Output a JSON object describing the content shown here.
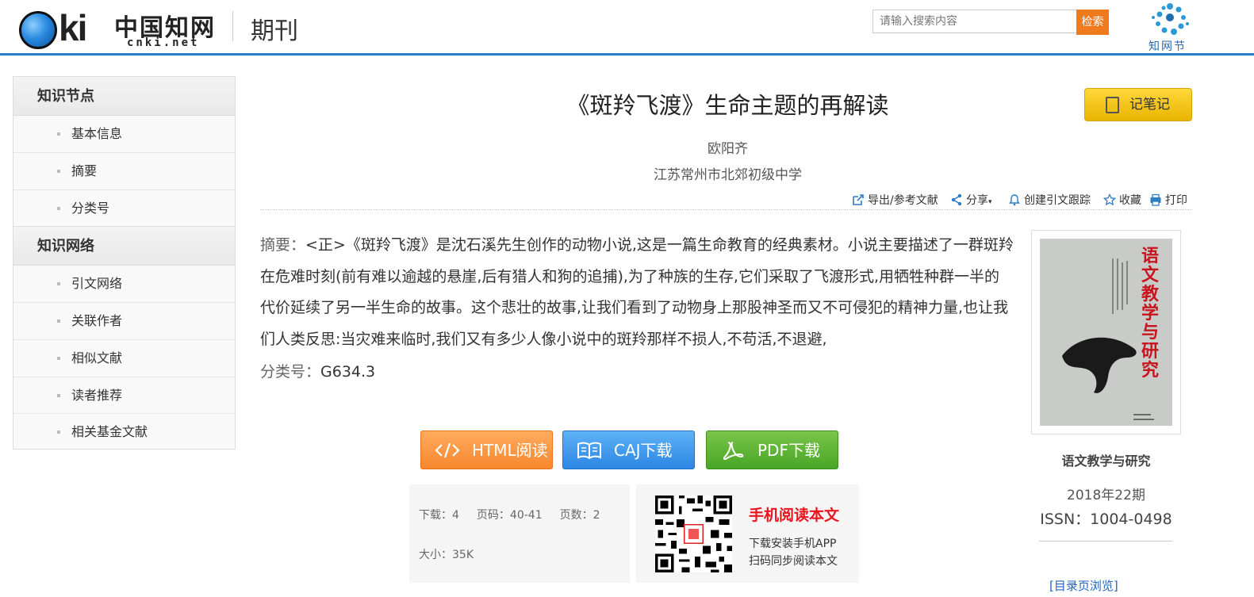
{
  "header": {
    "logo_mark": "CNKi",
    "logo_cn": "中国知网",
    "logo_domain": "cnki.net",
    "section_title": "期刊",
    "search_placeholder": "请输入搜索内容",
    "search_button": "检索",
    "zwj_label": "知网节",
    "accent_color": "#2b7dc6"
  },
  "sidebar": {
    "groups": [
      {
        "heading": "知识节点",
        "items": [
          "基本信息",
          "摘要",
          "分类号"
        ]
      },
      {
        "heading": "知识网络",
        "items": [
          "引文网络",
          "关联作者",
          "相似文献",
          "读者推荐",
          "相关基金文献"
        ]
      }
    ]
  },
  "article": {
    "title": "《斑羚飞渡》生命主题的再解读",
    "author": "欧阳齐",
    "organization": "江苏常州市北郊初级中学",
    "note_button": "记笔记",
    "toolbar": {
      "export": "导出/参考文献",
      "share": "分享",
      "citation_track": "创建引文跟踪",
      "favorite": "收藏",
      "print": "打印"
    },
    "abstract_label": "摘要：",
    "abstract_text": "<正>《斑羚飞渡》是沈石溪先生创作的动物小说,这是一篇生命教育的经典素材。小说主要描述了一群斑羚在危难时刻(前有难以逾越的悬崖,后有猎人和狗的追捕),为了种族的生存,它们采取了飞渡形式,用牺牲种群一半的代价延续了另一半生命的故事。这个悲壮的故事,让我们看到了动物身上那股神圣而又不可侵犯的精神力量,也让我们人类反思:当灾难来临时,我们又有多少人像小说中的斑羚那样不损人,不苟活,不退避,",
    "class_label": "分类号：",
    "class_code": "G634.3"
  },
  "buttons": {
    "html_read": "HTML阅读",
    "caj_download": "CAJ下载",
    "pdf_download": "PDF下载",
    "html_color": "#f7872e",
    "caj_color": "#2c86e3",
    "pdf_color": "#49a526"
  },
  "stats": {
    "downloads": "下载：4",
    "pages": "页码：40-41",
    "page_count": "页数：2",
    "size": "大小：35K"
  },
  "mobile": {
    "title": "手机阅读本文",
    "line1": "下载安装手机APP",
    "line2": "扫码同步阅读本文"
  },
  "journal": {
    "name": "语文教学与研究",
    "issue": "2018年22期",
    "issn": "ISSN：1004-0498",
    "toc_link": "[目录页浏览]",
    "cover_title": "语文教学与研究"
  }
}
